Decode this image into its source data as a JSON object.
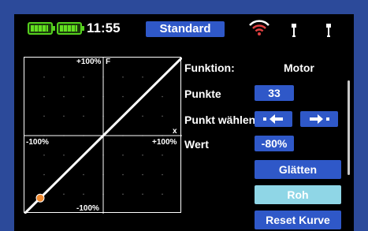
{
  "status": {
    "time": "11:55",
    "model_name": "Standard"
  },
  "graph": {
    "label_top": "+100%",
    "label_f": "F",
    "label_left": "-100%",
    "label_right": "+100%",
    "label_x": "x",
    "label_bottom": "-100%",
    "selected_point": {
      "x": -80,
      "y": -80
    }
  },
  "panel": {
    "funktion_label": "Funktion:",
    "funktion_value": "Motor",
    "punkte_label": "Punkte",
    "punkte_value": "33",
    "punkt_waehlen_label": "Punkt wählen",
    "wert_label": "Wert",
    "wert_value": "-80%",
    "glaetten_label": "Glätten",
    "roh_label": "Roh",
    "reset_label": "Reset Kurve"
  },
  "colors": {
    "accent": "#2f58c8",
    "active": "#8fd6e6",
    "battery": "#55d01e",
    "point": "#f08a30"
  }
}
